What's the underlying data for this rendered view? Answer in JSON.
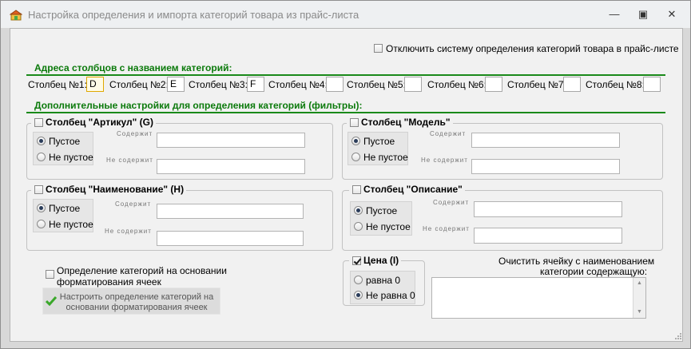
{
  "window": {
    "title": "Настройка определения и импорта категорий товара из прайс-листа",
    "minimize_symbol": "—",
    "maximize_symbol": "▣",
    "close_symbol": "✕"
  },
  "disable_system": {
    "label": "Отключить систему определения категорий товара в прайс-листе",
    "checked": false
  },
  "section_columns": {
    "title": "Адреса столбцов с названием категорий:"
  },
  "columns": [
    {
      "label": "Столбец №1:",
      "value": "D"
    },
    {
      "label": "Столбец №2:",
      "value": "E"
    },
    {
      "label": "Столбец №3:",
      "value": "F"
    },
    {
      "label": "Столбец №4:",
      "value": ""
    },
    {
      "label": "Столбец №5:",
      "value": ""
    },
    {
      "label": "Столбец №6:",
      "value": ""
    },
    {
      "label": "Столбец №7:",
      "value": ""
    },
    {
      "label": "Столбец №8:",
      "value": ""
    }
  ],
  "section_filters": {
    "title": "Дополнительные настройки для определения категорий (фильтры):"
  },
  "filters": {
    "article": {
      "title": "Столбец \"Артикул\" (G)",
      "empty": "Пустое",
      "not_empty": "Не пустое",
      "contains": "Содержит",
      "not_contains": "Не содержит"
    },
    "model": {
      "title": "Столбец \"Модель\"",
      "empty": "Пустое",
      "not_empty": "Не пустое",
      "contains": "Содержит",
      "not_contains": "Не содержит"
    },
    "name": {
      "title": "Столбец \"Наименование\" (H)",
      "empty": "Пустое",
      "not_empty": "Не пустое",
      "contains": "Содержит",
      "not_contains": "Не содержит"
    },
    "description": {
      "title": "Столбец \"Описание\"",
      "empty": "Пустое",
      "not_empty": "Не пустое",
      "contains": "Содержит",
      "not_contains": "Не содержит"
    }
  },
  "formatting": {
    "checkbox_line1": "Определение категорий на основании",
    "checkbox_line2": "форматирования ячеек",
    "button_line1": "Настроить определение категорий на",
    "button_line2": "основании форматирования ячеек",
    "button_icon": "green-checkmark-icon"
  },
  "price": {
    "title": "Цена (I)",
    "checked": true,
    "equal_zero": "равна 0",
    "not_equal_zero": "Не равна 0"
  },
  "clear": {
    "line1": "Очистить ячейку с наименованием",
    "line2": "категории содержащую:",
    "value": ""
  },
  "colors": {
    "section": "#0b7a0b",
    "section_line": "#1a8a1a",
    "active_box_border": "#e0a800"
  }
}
